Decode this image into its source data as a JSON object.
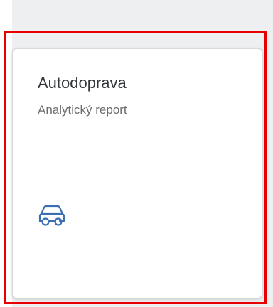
{
  "tile": {
    "title": "Autodoprava",
    "subtitle": "Analytický report",
    "icon": "car-icon",
    "icon_color": "#0a6ed1"
  },
  "colors": {
    "highlight": "#e60000",
    "background": "#edeff0",
    "title_text": "#32363a",
    "subtitle_text": "#6a6d70"
  }
}
